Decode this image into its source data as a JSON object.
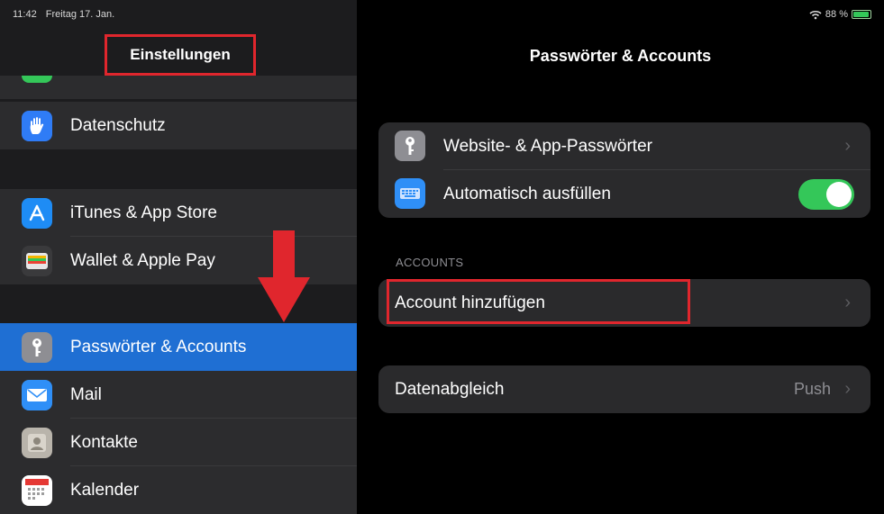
{
  "status_bar": {
    "time": "11:42",
    "date": "Freitag 17. Jan.",
    "battery_percent": "88 %"
  },
  "sidebar": {
    "title": "Einstellungen",
    "items": [
      {
        "label": "Datenschutz",
        "icon": "hand-icon",
        "color": "#2f7cf6"
      },
      {
        "label": "iTunes & App Store",
        "icon": "app-store-icon",
        "color": "#1e8cf5"
      },
      {
        "label": "Wallet & Apple Pay",
        "icon": "wallet-icon",
        "color": "#3a3a3c"
      },
      {
        "label": "Passwörter & Accounts",
        "icon": "key-icon",
        "color": "#8e8e93",
        "selected": true
      },
      {
        "label": "Mail",
        "icon": "mail-icon",
        "color": "#2f8ff7"
      },
      {
        "label": "Kontakte",
        "icon": "contacts-icon",
        "color": "#b9b4ab"
      },
      {
        "label": "Kalender",
        "icon": "calendar-icon",
        "color": "#ffffff"
      }
    ]
  },
  "detail": {
    "title": "Passwörter & Accounts",
    "group1": [
      {
        "label": "Website- & App-Passwörter",
        "icon": "key-icon"
      },
      {
        "label": "Automatisch ausfüllen",
        "icon": "keyboard-icon",
        "toggle_on": true
      }
    ],
    "accounts_header": "ACCOUNTS",
    "add_account": "Account hinzufügen",
    "fetch": {
      "label": "Datenabgleich",
      "value": "Push"
    }
  },
  "colors": {
    "accent_selected": "#1f6fd3",
    "annotation_red": "#e0262d",
    "toggle_green": "#34c759"
  }
}
